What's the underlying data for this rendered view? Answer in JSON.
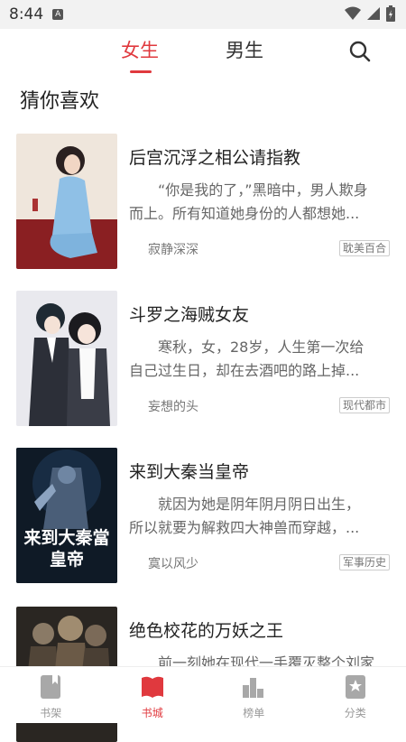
{
  "status_bar": {
    "time": "8:44",
    "notification_badge": "A",
    "icons": [
      "wifi-icon",
      "cellular-signal-icon",
      "battery-icon"
    ]
  },
  "top_tabs": [
    {
      "label": "女生",
      "active": true
    },
    {
      "label": "男生",
      "active": false
    }
  ],
  "search_icon": "search-icon",
  "section_title": "猜你喜欢",
  "books": [
    {
      "title": "后宫沉浮之相公请指教",
      "desc_line1": "“你是我的了，”黑暗中，男人欺身",
      "desc_line2": "而上。所有知道她身份的人都想她...",
      "author": "寂静深深",
      "tag": "耽美百合"
    },
    {
      "title": "斗罗之海贼女友",
      "desc_line1": "寒秋，女，28岁，人生第一次给",
      "desc_line2": "自己过生日，却在去酒吧的路上掉...",
      "author": "妄想的头",
      "tag": "现代都市"
    },
    {
      "title": "来到大秦当皇帝",
      "desc_line1": "就因为她是阴年阴月阴日出生，",
      "desc_line2": "所以就要为解救四大神兽而穿越，...",
      "author": "寞以风少",
      "tag": "军事历史",
      "cover_text_line1": "来到大秦當",
      "cover_text_line2": "皇帝"
    },
    {
      "title": "绝色校花的万妖之王",
      "desc_line1": "前一刻她在现代一手覆灭整个刘家"
    }
  ],
  "bottom_nav": [
    {
      "label": "书架",
      "icon": "bookshelf-icon",
      "active": false
    },
    {
      "label": "书城",
      "icon": "book-store-icon",
      "active": true
    },
    {
      "label": "榜单",
      "icon": "ranking-icon",
      "active": false
    },
    {
      "label": "分类",
      "icon": "category-icon",
      "active": false
    }
  ],
  "colors": {
    "accent": "#e0393e",
    "text_primary": "#222222",
    "text_secondary": "#666666",
    "inactive": "#999999"
  }
}
